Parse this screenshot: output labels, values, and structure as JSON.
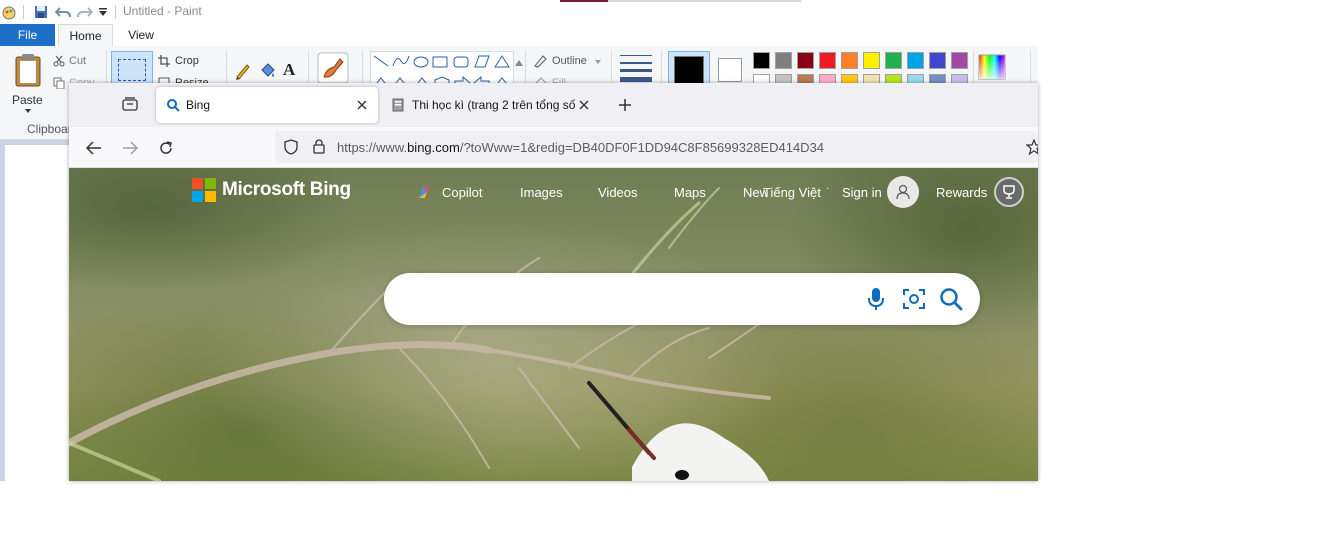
{
  "paint": {
    "title": "Untitled - Paint",
    "tabs": {
      "file": "File",
      "home": "Home",
      "view": "View"
    },
    "ribbon": {
      "paste": "Paste",
      "cut": "Cut",
      "copy": "Copy",
      "clipboard_group": "Clipboard",
      "crop": "Crop",
      "resize": "Resize",
      "outline": "Outline",
      "fill": "Fill"
    },
    "palette_row1": [
      "#000000",
      "#7f7f7f",
      "#880015",
      "#ed1c24",
      "#ff7f27",
      "#fff200",
      "#22b14c",
      "#00a2e8",
      "#3f48cc",
      "#a349a4"
    ],
    "palette_row2": [
      "#ffffff",
      "#c3c3c3",
      "#b97a57",
      "#ffaec9",
      "#ffc90e",
      "#efe4b0",
      "#b5e61d",
      "#99d9ea",
      "#7092be",
      "#c8bfe7"
    ],
    "color1": "#000000",
    "color2": "#ffffff"
  },
  "firefox": {
    "tabs": [
      {
        "title": "Bing"
      },
      {
        "title": "Thi học kì (trang 2 trên tổng số"
      }
    ],
    "url": {
      "prefix": "https://www.",
      "domain": "bing.com",
      "rest": "/?toWww=1&redig=DB40DF0F1DD94C8F85699328ED414D34"
    }
  },
  "bing": {
    "logo_text": "Microsoft Bing",
    "nav": [
      "Copilot",
      "Images",
      "Videos",
      "Maps",
      "News"
    ],
    "language": "Tiếng Việt",
    "sign_in": "Sign in",
    "rewards": "Rewards",
    "search_placeholder": "",
    "accent": "#0f7a9c"
  }
}
